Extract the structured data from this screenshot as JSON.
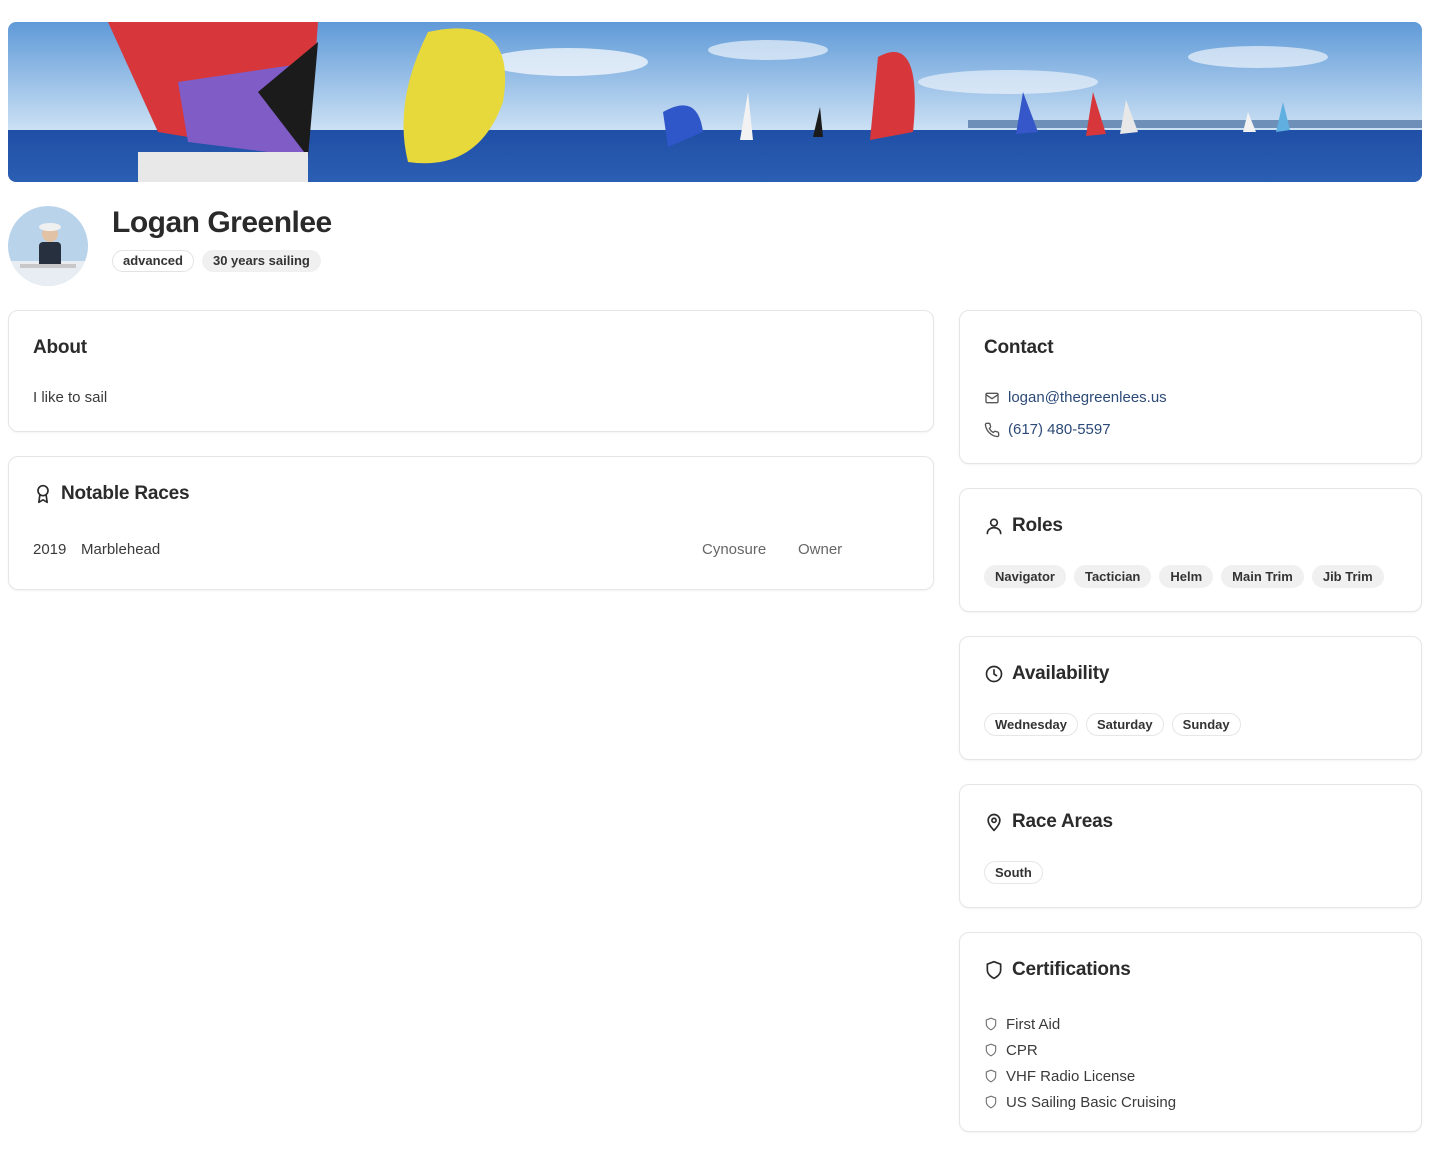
{
  "profile": {
    "name": "Logan Greenlee",
    "badges": [
      "advanced",
      "30 years sailing"
    ]
  },
  "about": {
    "title": "About",
    "text": "I like to sail"
  },
  "notable_races": {
    "title": "Notable Races",
    "rows": [
      {
        "year": "2019",
        "name": "Marblehead",
        "boat": "Cynosure",
        "role": "Owner"
      }
    ]
  },
  "contact": {
    "title": "Contact",
    "email": "logan@thegreenlees.us",
    "phone": "(617) 480-5597"
  },
  "roles": {
    "title": "Roles",
    "items": [
      "Navigator",
      "Tactician",
      "Helm",
      "Main Trim",
      "Jib Trim"
    ]
  },
  "availability": {
    "title": "Availability",
    "items": [
      "Wednesday",
      "Saturday",
      "Sunday"
    ]
  },
  "race_areas": {
    "title": "Race Areas",
    "items": [
      "South"
    ]
  },
  "certifications": {
    "title": "Certifications",
    "items": [
      "First Aid",
      "CPR",
      "VHF Radio License",
      "US Sailing Basic Cruising"
    ]
  },
  "icons": {
    "email": "mail-icon",
    "phone": "phone-icon",
    "races": "award-icon",
    "roles": "user-icon",
    "availability": "clock-icon",
    "race_areas": "map-pin-icon",
    "certifications": "shield-icon"
  },
  "colors": {
    "link": "#2c4a78",
    "chip_fill": "#f0f0f0",
    "card_border": "#e6e6e6"
  }
}
